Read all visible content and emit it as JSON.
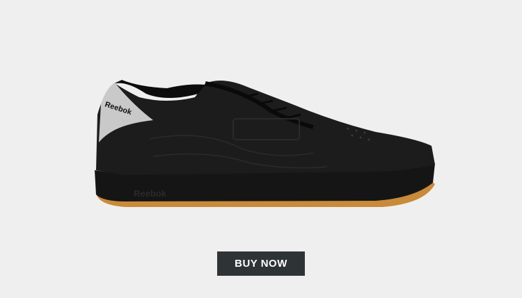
{
  "product": {
    "image_icon": "reebok-club-c-85-black-sneaker",
    "brand_text": "Reebok",
    "colors": {
      "upper": "#1c1c1c",
      "heel_tab": "#c9c9c9",
      "gum_sole": "#c98a3a",
      "background": "#efefef"
    }
  },
  "cta": {
    "label": "BUY NOW",
    "color": "#2e3336"
  }
}
